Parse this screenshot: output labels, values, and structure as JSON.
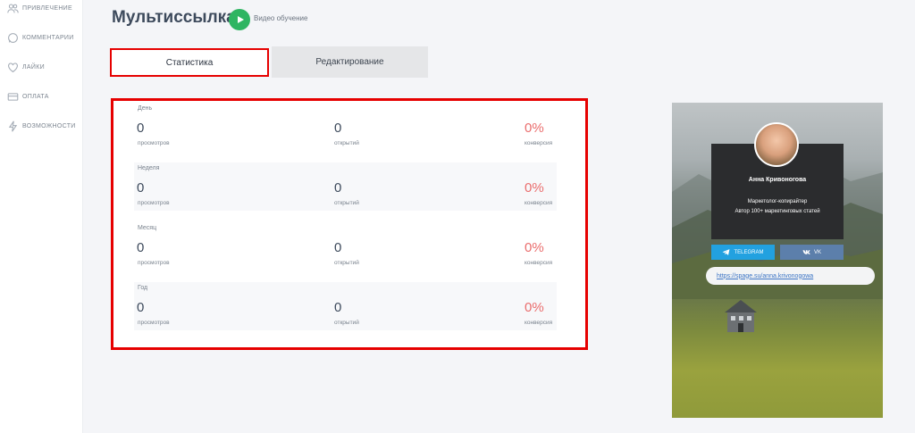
{
  "sidebar": {
    "items": [
      {
        "label": "ПРИВЛЕЧЕНИЕ",
        "icon": "users-icon"
      },
      {
        "label": "КОММЕНТАРИИ",
        "icon": "whatsapp-icon"
      },
      {
        "label": "ЛАЙКИ",
        "icon": "heart-icon"
      },
      {
        "label": "ОПЛАТА",
        "icon": "credit-card-icon"
      },
      {
        "label": "ВОЗМОЖНОСТИ",
        "icon": "lightning-icon"
      }
    ]
  },
  "header": {
    "title": "Мультиссылка",
    "video_label": "Видео обучение"
  },
  "tabs": [
    {
      "label": "Статистика",
      "active": true
    },
    {
      "label": "Редактирование",
      "active": false
    }
  ],
  "stats": [
    {
      "period": "День",
      "views": "0",
      "views_label": "просмотров",
      "opens": "0",
      "opens_label": "открытий",
      "conversion": "0%",
      "conversion_label": "конверсия"
    },
    {
      "period": "Неделя",
      "views": "0",
      "views_label": "просмотров",
      "opens": "0",
      "opens_label": "открытий",
      "conversion": "0%",
      "conversion_label": "конверсия"
    },
    {
      "period": "Месяц",
      "views": "0",
      "views_label": "просмотров",
      "opens": "0",
      "opens_label": "открытий",
      "conversion": "0%",
      "conversion_label": "конверсия"
    },
    {
      "period": "Год",
      "views": "0",
      "views_label": "просмотров",
      "opens": "0",
      "opens_label": "открытий",
      "conversion": "0%",
      "conversion_label": "конверсия"
    }
  ],
  "preview": {
    "name": "Анна Кривоногова",
    "role": "Маркетолог-копирайтер",
    "description": "Автор 100+ маркетинговых статей",
    "telegram_label": "TELEGRAM",
    "vk_label": "VK",
    "link": "https://spage.su/anna.krivonogowa"
  },
  "colors": {
    "highlight": "#e60000",
    "accent_green": "#2fb562",
    "conversion": "#ea6d6d",
    "telegram": "#22a1e0",
    "vk": "#5c7fab"
  }
}
